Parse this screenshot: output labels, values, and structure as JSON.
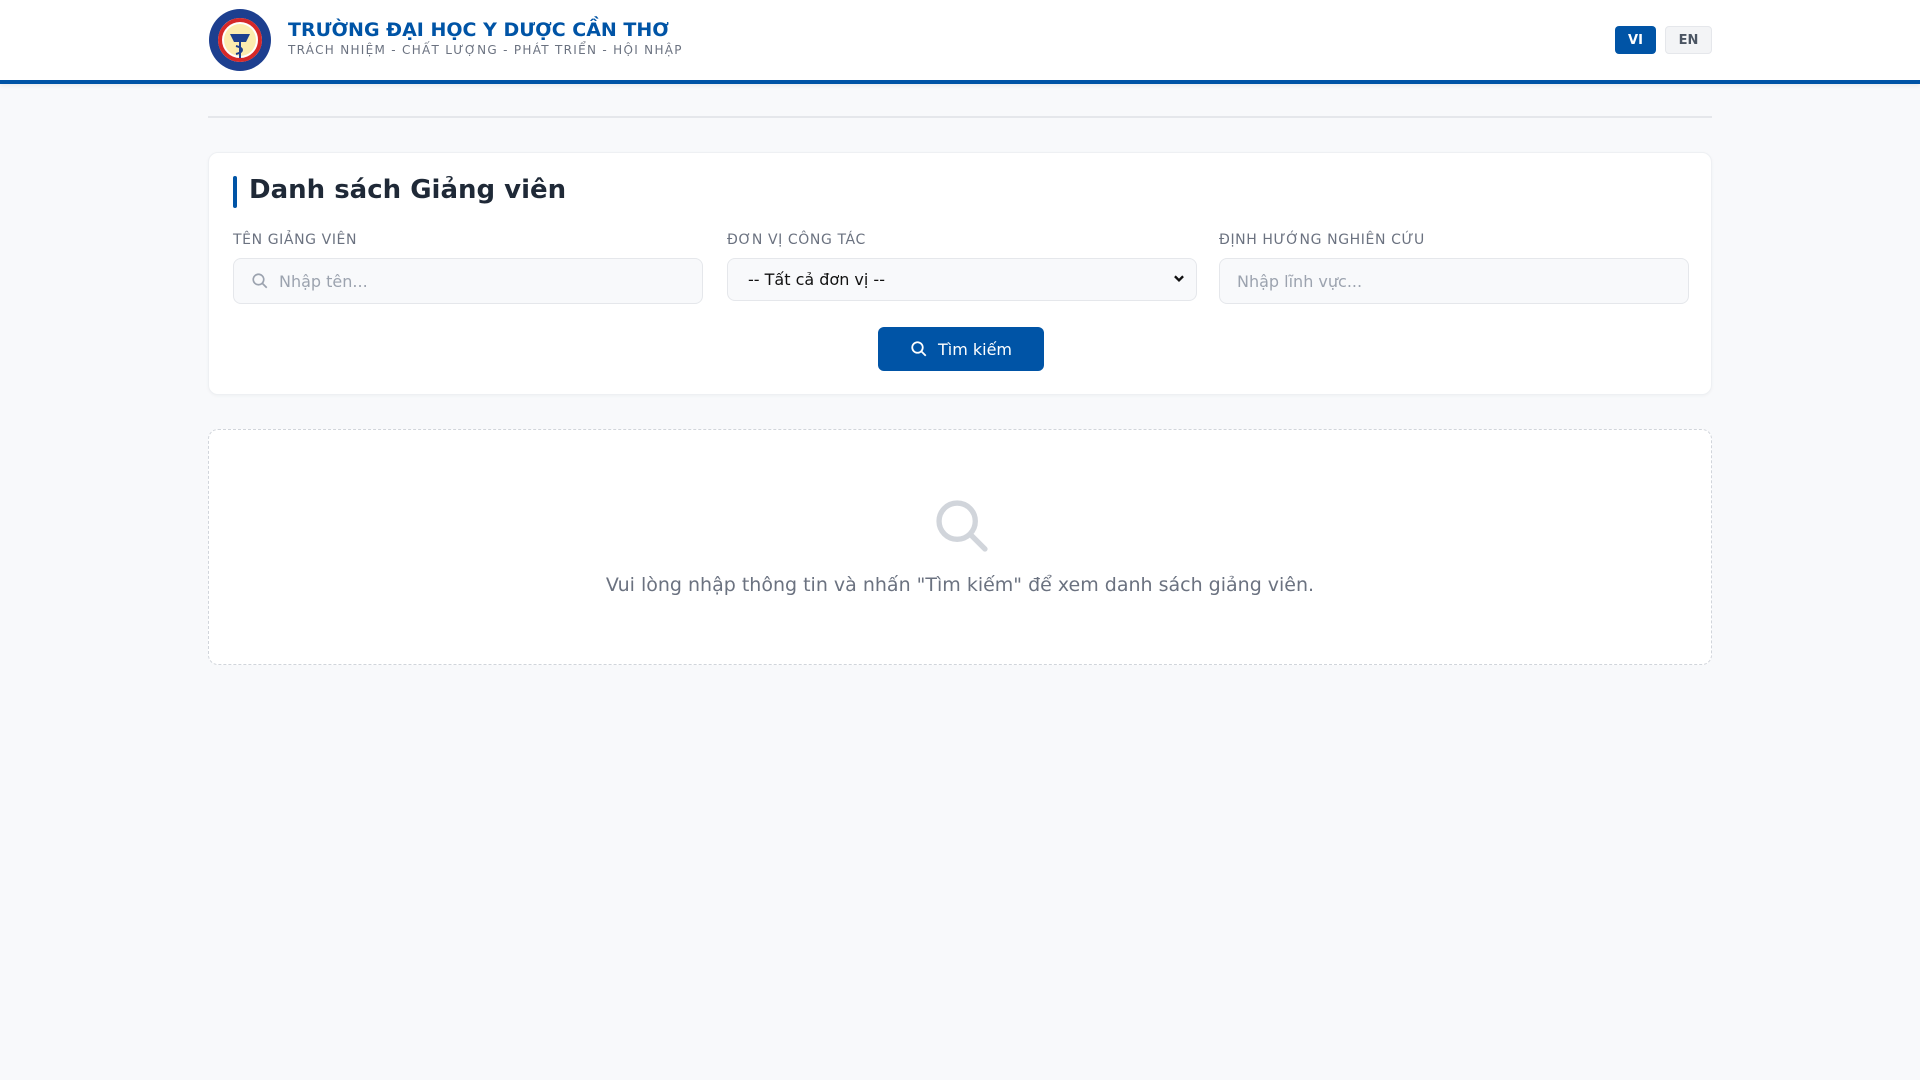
{
  "header": {
    "title": "TRƯỜNG ĐẠI HỌC Y DƯỢC CẦN THƠ",
    "subtitle": "TRÁCH NHIỆM - CHẤT LƯỢNG - PHÁT TRIỂN - HỘI NHẬP",
    "lang_vi": "VI",
    "lang_en": "EN"
  },
  "search": {
    "title": "Danh sách Giảng viên",
    "name_label": "TÊN GIẢNG VIÊN",
    "name_placeholder": "Nhập tên...",
    "unit_label": "ĐƠN VỊ CÔNG TÁC",
    "unit_selected": "-- Tất cả đơn vị --",
    "research_label": "ĐỊNH HƯỚNG NGHIÊN CỨU",
    "research_placeholder": "Nhập lĩnh vực...",
    "button": "Tìm kiếm"
  },
  "empty": {
    "message": "Vui lòng nhập thông tin và nhấn \"Tìm kiếm\" để xem danh sách giảng viên."
  },
  "colors": {
    "brand": "#0054a6"
  }
}
